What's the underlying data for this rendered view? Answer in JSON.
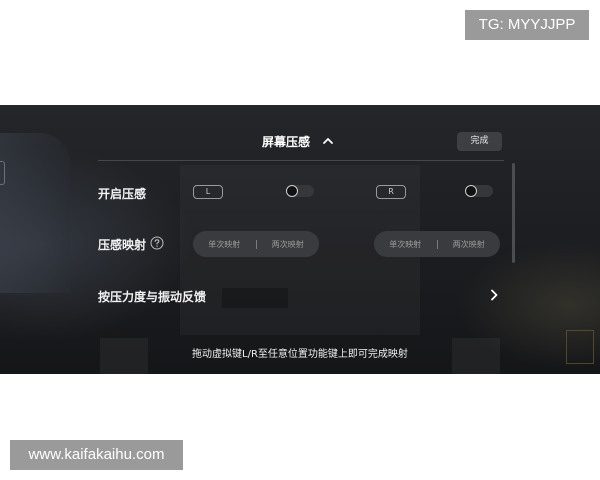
{
  "watermarks": {
    "top_right": "TG: MYYJJPP",
    "bottom_left": "www.kaifakaihu.com"
  },
  "panel": {
    "title": "屏幕压感",
    "done_label": "完成",
    "rows": {
      "enable": {
        "label": "开启压感",
        "left_key": "L",
        "right_key": "R"
      },
      "mapping": {
        "label": "压感映射",
        "left_options": [
          "单次映射",
          "两次映射"
        ],
        "right_options": [
          "单次映射",
          "两次映射"
        ]
      },
      "feedback": {
        "label": "按压力度与振动反馈"
      }
    },
    "hint": "拖动虚拟键L/R至任意位置功能键上即可完成映射"
  },
  "icons": {
    "title_chevron": "chevron-up-icon",
    "help": "question-circle-icon",
    "feedback_arrow": "chevron-right-icon"
  },
  "colors": {
    "panel_bg": "#1c1d20",
    "text": "#ffffff",
    "muted": "#9c9c9c",
    "control_bg": "#3a3b3e"
  }
}
